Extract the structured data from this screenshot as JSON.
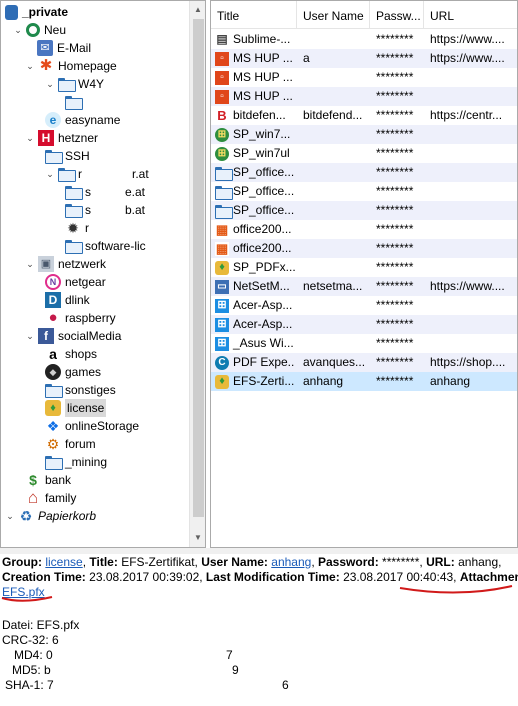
{
  "tree": {
    "nodes": [
      {
        "label": "_private",
        "icon": "database-icon",
        "toggle": "",
        "bold": true
      },
      {
        "label": "Neu",
        "icon": "neu-icon",
        "toggle": "v"
      },
      {
        "label": "E-Mail",
        "icon": "email-icon",
        "toggle": ""
      },
      {
        "label": "Homepage",
        "icon": "joomla-icon",
        "toggle": "v"
      },
      {
        "label": "W4Y",
        "icon": "folder-icon",
        "toggle": "v"
      },
      {
        "label": "",
        "icon": "folder-icon",
        "toggle": ""
      },
      {
        "label": "easyname",
        "icon": "easyname-icon",
        "toggle": ""
      },
      {
        "label": "hetzner",
        "icon": "hetzner-icon",
        "toggle": "v"
      },
      {
        "label": "SSH",
        "icon": "folder-icon",
        "toggle": ""
      },
      {
        "label": "r",
        "label_tail": "r.at",
        "icon": "folder-icon",
        "toggle": "v"
      },
      {
        "label": "s",
        "label_tail": "e.at",
        "icon": "folder-icon",
        "toggle": ""
      },
      {
        "label": "s",
        "label_tail": "b.at",
        "icon": "folder-icon",
        "toggle": ""
      },
      {
        "label": "r",
        "icon": "gear-icon",
        "toggle": ""
      },
      {
        "label": "software-lic",
        "icon": "folder-icon",
        "toggle": ""
      },
      {
        "label": "netzwerk",
        "icon": "network-icon",
        "toggle": "v"
      },
      {
        "label": "netgear",
        "icon": "netgear-icon",
        "toggle": ""
      },
      {
        "label": "dlink",
        "icon": "dlink-icon",
        "toggle": ""
      },
      {
        "label": "raspberry",
        "icon": "raspberry-icon",
        "toggle": ""
      },
      {
        "label": "socialMedia",
        "icon": "facebook-icon",
        "toggle": "v"
      },
      {
        "label": "shops",
        "icon": "amazon-icon",
        "toggle": ""
      },
      {
        "label": "games",
        "icon": "games-icon",
        "toggle": ""
      },
      {
        "label": "sonstiges",
        "icon": "folder-icon",
        "toggle": ""
      },
      {
        "label": "license",
        "icon": "license-icon",
        "toggle": "",
        "selected": true
      },
      {
        "label": "onlineStorage",
        "icon": "dropbox-icon",
        "toggle": ""
      },
      {
        "label": "forum",
        "icon": "forum-icon",
        "toggle": ""
      },
      {
        "label": "_mining",
        "icon": "folder-icon",
        "toggle": ""
      },
      {
        "label": "bank",
        "icon": "dollar-icon",
        "toggle": ""
      },
      {
        "label": "family",
        "icon": "house-icon",
        "toggle": ""
      },
      {
        "label": "Papierkorb",
        "icon": "recycle-bin-icon",
        "toggle": "v",
        "italic": true
      }
    ]
  },
  "list": {
    "columns": [
      "Title",
      "User Name",
      "Passw...",
      "URL"
    ],
    "rows": [
      {
        "title": "Sublime-...",
        "user": "",
        "password": "********",
        "url": "https://www....",
        "icon": "document-icon"
      },
      {
        "title": "MS HUP ...",
        "user": "a",
        "password": "********",
        "url": "https://www....",
        "icon": "office-icon"
      },
      {
        "title": "MS HUP ...",
        "user": "",
        "password": "********",
        "url": "",
        "icon": "office-icon"
      },
      {
        "title": "MS HUP ...",
        "user": "",
        "password": "********",
        "url": "",
        "icon": "office-icon"
      },
      {
        "title": "bitdefen...",
        "user": "bitdefend...",
        "password": "********",
        "url": "https://centr...",
        "icon": "bitdefender-icon"
      },
      {
        "title": "SP_win7...",
        "user": "",
        "password": "********",
        "url": "",
        "icon": "windows7-icon"
      },
      {
        "title": "SP_win7ul",
        "user": "",
        "password": "********",
        "url": "",
        "icon": "windows7-icon"
      },
      {
        "title": "SP_office...",
        "user": "",
        "password": "********",
        "url": "",
        "icon": "folder-icon"
      },
      {
        "title": "SP_office...",
        "user": "",
        "password": "********",
        "url": "",
        "icon": "folder-icon"
      },
      {
        "title": "SP_office...",
        "user": "",
        "password": "********",
        "url": "",
        "icon": "folder-icon"
      },
      {
        "title": "office200...",
        "user": "",
        "password": "********",
        "url": "",
        "icon": "office2007-icon"
      },
      {
        "title": "office200...",
        "user": "",
        "password": "********",
        "url": "",
        "icon": "office2007-icon"
      },
      {
        "title": "SP_PDFx...",
        "user": "",
        "password": "********",
        "url": "",
        "icon": "license-icon"
      },
      {
        "title": "NetSetM...",
        "user": "netsetma...",
        "password": "********",
        "url": "https://www....",
        "icon": "monitor-icon"
      },
      {
        "title": "Acer-Asp...",
        "user": "",
        "password": "********",
        "url": "",
        "icon": "windows-icon"
      },
      {
        "title": "Acer-Asp...",
        "user": "",
        "password": "********",
        "url": "",
        "icon": "windows-icon"
      },
      {
        "title": "_Asus Wi...",
        "user": "",
        "password": "********",
        "url": "",
        "icon": "windows-icon"
      },
      {
        "title": "PDF Expe...",
        "user": "avanques...",
        "password": "********",
        "url": "https://shop....",
        "icon": "pdf-expert-icon"
      },
      {
        "title": "EFS-Zerti...",
        "user": "anhang",
        "password": "********",
        "url": "anhang",
        "icon": "license-icon",
        "selected": true
      }
    ]
  },
  "detail": {
    "group_label": "Group:",
    "group_value": "license",
    "title_label": "Title:",
    "title_value": "EFS-Zertifikat,",
    "user_label": "User Name:",
    "user_value": "anhang",
    "password_label": "Password:",
    "password_value": "********,",
    "url_label": "URL:",
    "url_value": "anhang,",
    "creation_label": "Creation Time:",
    "creation_value": "23.08.2017 00:39:02,",
    "modification_label": "Last Modification Time:",
    "modification_value": "23.08.2017 00:40:43,",
    "attachments_label": "Attachments:",
    "attachment_file": "EFS.pfx",
    "datei_line": "Datei: EFS.pfx",
    "crc_label": "CRC-32: 6",
    "md4_label": "MD4: 0",
    "md4_tail": "7",
    "md5_label": "MD5: b",
    "md5_tail": "9",
    "sha1_label": "SHA-1: 7",
    "sha1_tail": "6"
  },
  "colors": {
    "selection_row": "#cde8ff",
    "alt_row": "#eef0fb",
    "link": "#1a5bb8",
    "annotation_red": "#d11a1a"
  }
}
